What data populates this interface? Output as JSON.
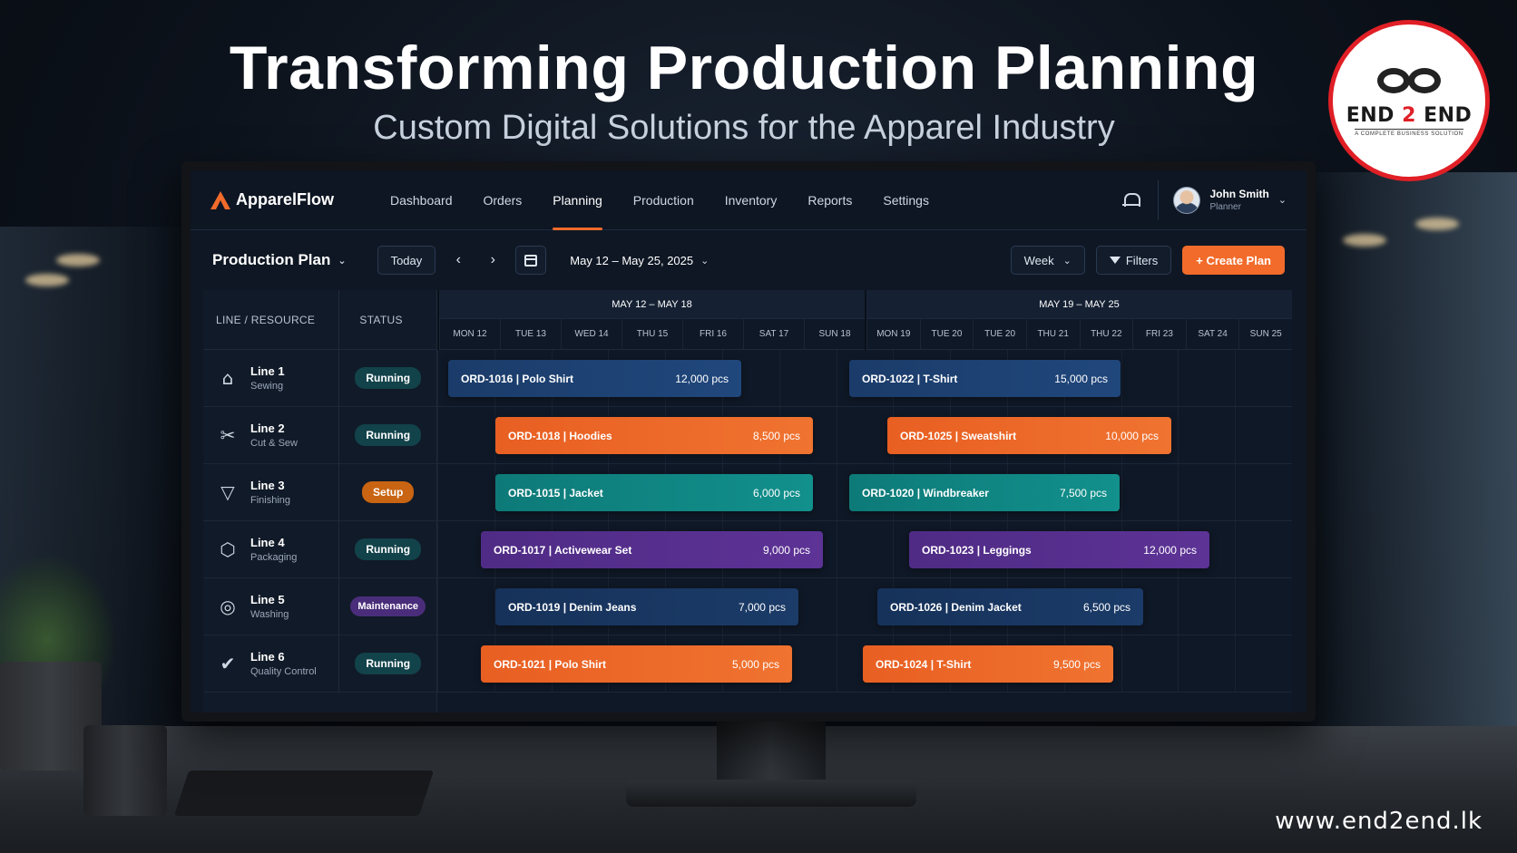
{
  "banner": {
    "title": "Transforming Production Planning",
    "subtitle": "Custom Digital Solutions for the Apparel Industry",
    "website": "www.end2end.lk"
  },
  "logo": {
    "name_part1": "END ",
    "name_part2": "2",
    "name_part3": " END",
    "tagline": "A COMPLETE BUSINESS SOLUTION"
  },
  "app": {
    "brand": "ApparelFlow",
    "nav": [
      "Dashboard",
      "Orders",
      "Planning",
      "Production",
      "Inventory",
      "Reports",
      "Settings"
    ],
    "active_nav": "Planning",
    "user": {
      "name": "John Smith",
      "role": "Planner"
    }
  },
  "toolbar": {
    "title": "Production Plan",
    "today": "Today",
    "date_range": "May 12 – May 25, 2025",
    "view": "Week",
    "filters": "Filters",
    "create": "+ Create Plan"
  },
  "grid": {
    "col_line": "LINE / RESOURCE",
    "col_status": "STATUS",
    "weeks": [
      {
        "label": "MAY 12 – MAY 18",
        "days": [
          "MON 12",
          "TUE 13",
          "WED 14",
          "THU 15",
          "FRI 16",
          "SAT 17",
          "SUN 18"
        ]
      },
      {
        "label": "MAY 19 – MAY 25",
        "days": [
          "MON 19",
          "TUE 20",
          "TUE 20",
          "THU 21",
          "THU 22",
          "FRI 23",
          "SAT 24",
          "SUN 25"
        ]
      }
    ],
    "lines": [
      {
        "name": "Line 1",
        "sub": "Sewing",
        "status": "Running",
        "status_type": "running",
        "icon": "sewing-machine-icon"
      },
      {
        "name": "Line 2",
        "sub": "Cut & Sew",
        "status": "Running",
        "status_type": "running",
        "icon": "scissors-icon"
      },
      {
        "name": "Line 3",
        "sub": "Finishing",
        "status": "Setup",
        "status_type": "setup",
        "icon": "tshirt-icon"
      },
      {
        "name": "Line 4",
        "sub": "Packaging",
        "status": "Running",
        "status_type": "running",
        "icon": "box-icon"
      },
      {
        "name": "Line 5",
        "sub": "Washing",
        "status": "Maintenance",
        "status_type": "maint",
        "icon": "washing-machine-icon"
      },
      {
        "name": "Line 6",
        "sub": "Quality Control",
        "status": "Running",
        "status_type": "running",
        "icon": "check-circle-icon"
      }
    ],
    "orders": [
      {
        "lane": 0,
        "order": "ORD-1016 | Polo Shirt",
        "qty": "12,000 pcs",
        "color": "navy"
      },
      {
        "lane": 0,
        "order": "ORD-1022 | T-Shirt",
        "qty": "15,000 pcs",
        "color": "navy"
      },
      {
        "lane": 1,
        "order": "ORD-1018 | Hoodies",
        "qty": "8,500 pcs",
        "color": "orange"
      },
      {
        "lane": 1,
        "order": "ORD-1025 | Sweatshirt",
        "qty": "10,000 pcs",
        "color": "orange"
      },
      {
        "lane": 2,
        "order": "ORD-1015 | Jacket",
        "qty": "6,000 pcs",
        "color": "teal"
      },
      {
        "lane": 2,
        "order": "ORD-1020 | Windbreaker",
        "qty": "7,500 pcs",
        "color": "teal"
      },
      {
        "lane": 3,
        "order": "ORD-1017 | Activewear Set",
        "qty": "9,000 pcs",
        "color": "purple"
      },
      {
        "lane": 3,
        "order": "ORD-1023 | Leggings",
        "qty": "12,000 pcs",
        "color": "purple"
      },
      {
        "lane": 4,
        "order": "ORD-1019 | Denim Jeans",
        "qty": "7,000 pcs",
        "color": "darkblue"
      },
      {
        "lane": 4,
        "order": "ORD-1026 | Denim Jacket",
        "qty": "6,500 pcs",
        "color": "darkblue"
      },
      {
        "lane": 5,
        "order": "ORD-1021 | Polo Shirt",
        "qty": "5,000 pcs",
        "color": "orange"
      },
      {
        "lane": 5,
        "order": "ORD-1024 | T-Shirt",
        "qty": "9,500 pcs",
        "color": "orange"
      }
    ]
  },
  "colors": {
    "accent": "#f26b2a",
    "logo_red": "#e01f26"
  }
}
